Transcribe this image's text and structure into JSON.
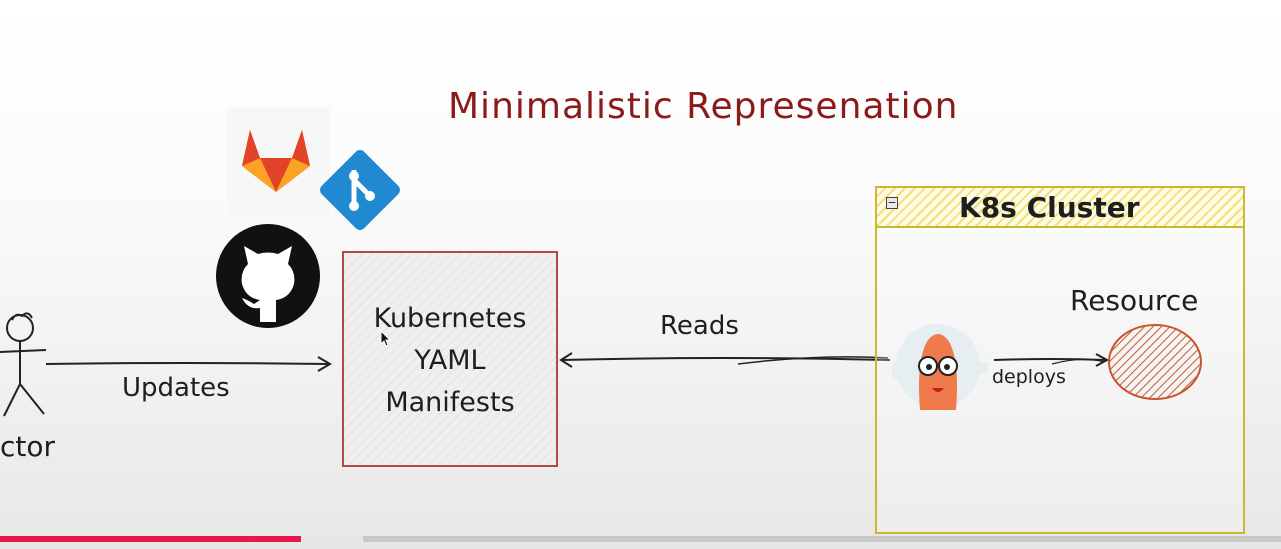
{
  "diagram": {
    "title": "Minimalistic Represenation",
    "actor_label": "ctor",
    "updates_label": "Updates",
    "manifest_lines": [
      "Kubernetes",
      "YAML",
      "Manifests"
    ],
    "reads_label": "Reads",
    "cluster_title": "K8s Cluster",
    "collapse_glyph": "−",
    "deploys_label": "deploys",
    "resource_label": "Resource"
  },
  "icons": [
    "gitlab-icon",
    "git-icon",
    "github-icon",
    "argo-icon",
    "actor-icon",
    "resource-icon"
  ],
  "colors": {
    "title": "#8b1a1a",
    "manifest_border": "#b04a4a",
    "cluster_border": "#c8b832",
    "resource": "#c9542a",
    "progress": "#e8194a"
  },
  "video_progress": {
    "played_fraction": 0.235,
    "buffered_fraction": 0.283
  }
}
